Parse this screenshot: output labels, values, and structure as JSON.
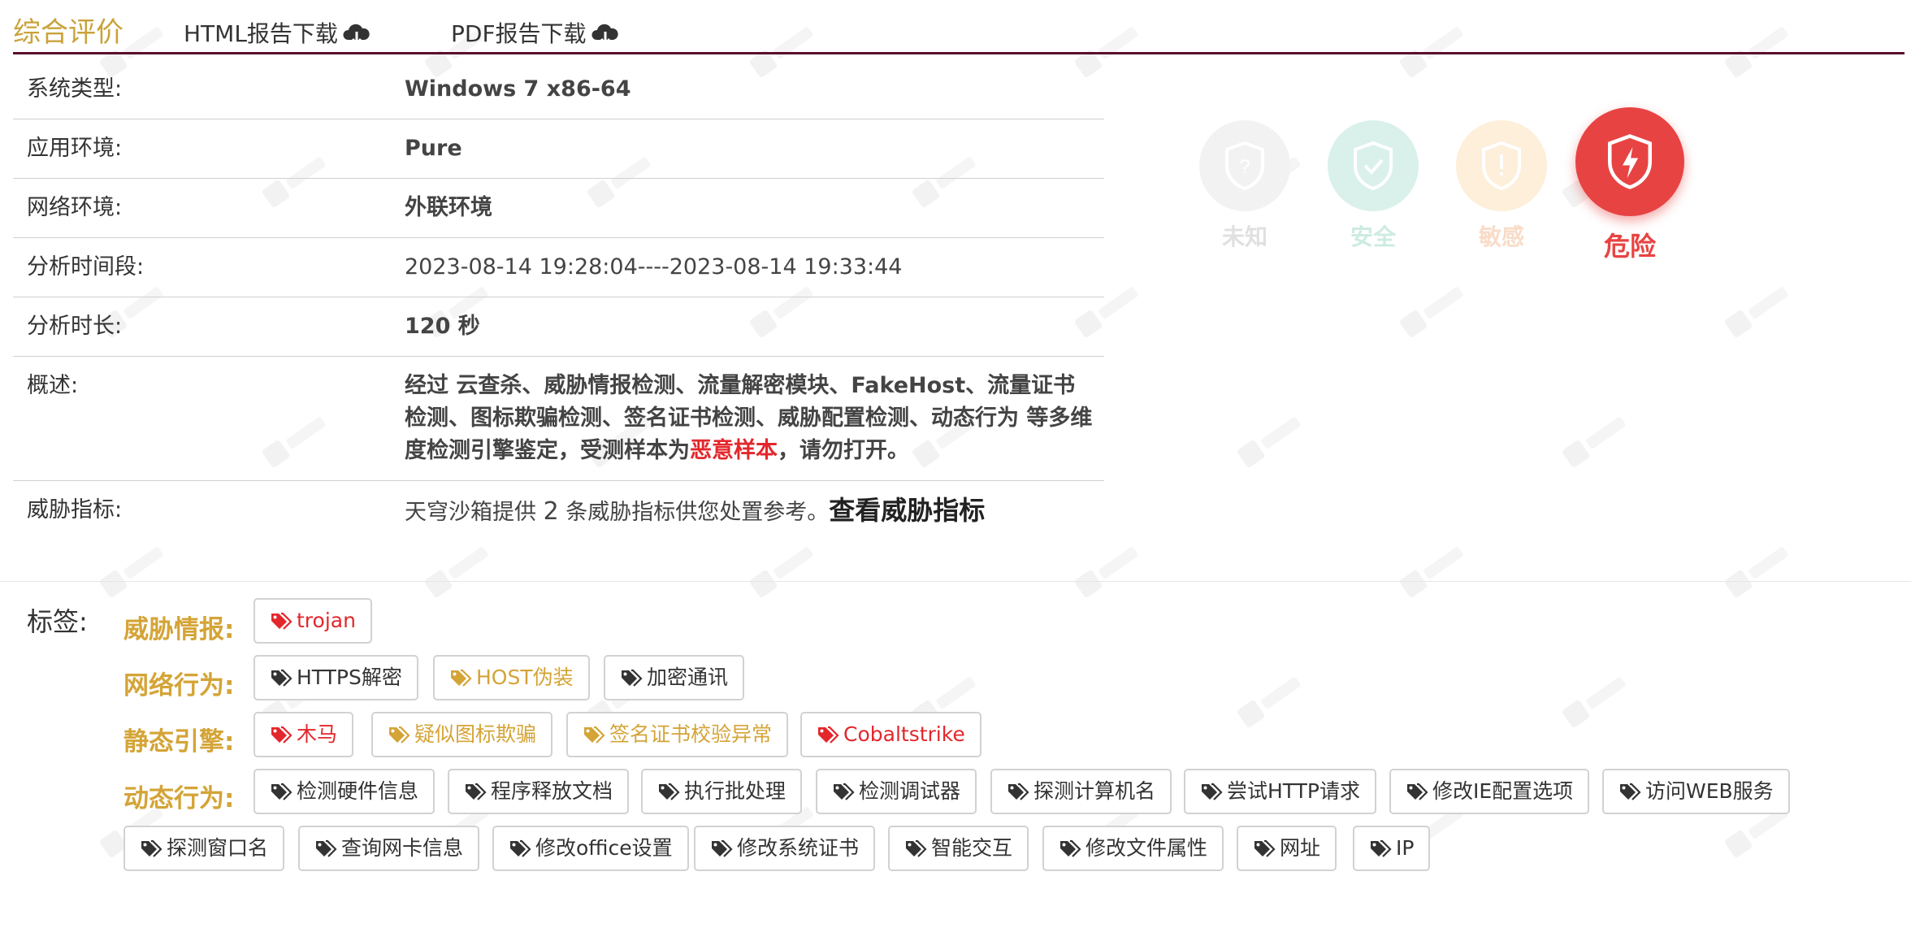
{
  "header": {
    "title": "综合评价",
    "html_download": "HTML报告下载",
    "pdf_download": "PDF报告下载"
  },
  "info": {
    "system_type": {
      "label": "系统类型:",
      "value": "Windows 7 x86-64"
    },
    "app_env": {
      "label": "应用环境:",
      "value": "Pure"
    },
    "network_env": {
      "label": "网络环境:",
      "value": "外联环境"
    },
    "analysis_period": {
      "label": "分析时间段:",
      "value": "2023-08-14 19:28:04----2023-08-14 19:33:44"
    },
    "analysis_duration": {
      "label": "分析时长:",
      "value": "120 秒"
    },
    "summary": {
      "label": "概述:",
      "text_before": "经过 云查杀、威胁情报检测、流量解密模块、FakeHost、流量证书检测、图标欺骗检测、签名证书检测、威胁配置检测、动态行为 等多维度检测引擎鉴定，受测样本为",
      "highlight": "恶意样本",
      "text_after": "，请勿打开。"
    },
    "threat_indicators": {
      "label": "威胁指标:",
      "text_a": "天穹沙箱提供 ",
      "count": "2",
      "text_b": " 条威胁指标供您处置参考。",
      "link": "查看威胁指标"
    }
  },
  "levels": {
    "unknown": "未知",
    "safe": "安全",
    "sensitive": "敏感",
    "danger": "危险",
    "active": "danger"
  },
  "tags": {
    "label": "标签:",
    "threat_intel": {
      "label": "威胁情报:",
      "items": [
        "trojan"
      ]
    },
    "network": {
      "label": "网络行为:",
      "items": [
        "HTTPS解密",
        "HOST伪装",
        "加密通讯"
      ]
    },
    "static": {
      "label": "静态引擎:",
      "items": [
        "木马",
        "疑似图标欺骗",
        "签名证书校验异常",
        "Cobaltstrike"
      ]
    },
    "dynamic": {
      "label": "动态行为:",
      "items": [
        "检测硬件信息",
        "程序释放文档",
        "执行批处理",
        "检测调试器",
        "探测计算机名",
        "尝试HTTP请求",
        "修改IE配置选项",
        "访问WEB服务",
        "探测窗口名",
        "查询网卡信息",
        "修改office设置",
        "修改系统证书",
        "智能交互",
        "修改文件属性",
        "网址",
        "IP"
      ]
    }
  },
  "colors": {
    "accent_gold": "#d4a437",
    "danger_red": "#e3272c",
    "header_rule": "#5b0f2c"
  }
}
